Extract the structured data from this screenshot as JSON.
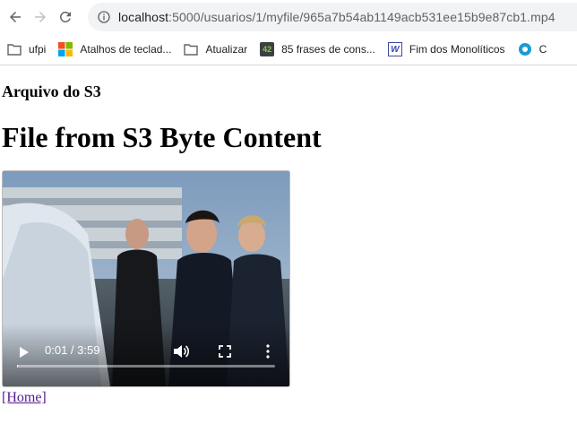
{
  "browser": {
    "url_host": "localhost",
    "url_path": ":5000/usuarios/1/myfile/965a7b54ab1149acb531ee15b9e87cb1.mp4",
    "bookmarks": [
      {
        "label": "ufpi",
        "icon": "folder-icon"
      },
      {
        "label": "Atalhos de teclad...",
        "icon": "windows-logo-icon"
      },
      {
        "label": "Atualizar",
        "icon": "folder-icon"
      },
      {
        "label": "85 frases de cons...",
        "icon": "badge-42-icon",
        "badge": "42"
      },
      {
        "label": "Fim dos Monolíticos",
        "icon": "w-logo-icon",
        "badge": "W"
      },
      {
        "label": "C",
        "icon": "circle-logo-icon"
      }
    ]
  },
  "page": {
    "subtitle": "Arquivo do S3",
    "title": "File from S3 Byte Content",
    "video": {
      "time_display": "0:01 / 3:59",
      "progress": 0.004
    },
    "home_link": "[Home]"
  }
}
